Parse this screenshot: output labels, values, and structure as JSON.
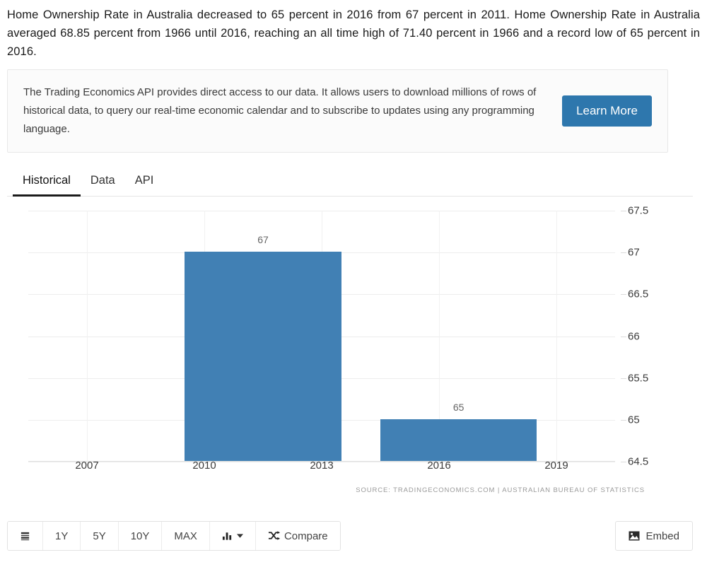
{
  "intro": {
    "paragraph": "Home Ownership Rate in Australia decreased to 65 percent in 2016 from 67 percent in 2011. Home Ownership Rate in Australia averaged 68.85 percent from 1966 until 2016, reaching an all time high of 71.40 percent in 1966 and a record low of 65 percent in 2016."
  },
  "api_banner": {
    "text": "The Trading Economics API provides direct access to our data. It allows users to download millions of rows of historical data, to query our real-time economic calendar and to subscribe to updates using any programming language.",
    "button_label": "Learn More",
    "button_color": "#2e77ad"
  },
  "tabs": [
    {
      "label": "Historical",
      "active": true
    },
    {
      "label": "Data",
      "active": false
    },
    {
      "label": "API",
      "active": false
    }
  ],
  "chart_data": {
    "type": "bar",
    "title": "",
    "xlabel": "",
    "ylabel": "",
    "categories": [
      2011,
      2016
    ],
    "values": [
      67,
      65
    ],
    "data_labels": [
      "67",
      "65"
    ],
    "bar_color": "#4180b4",
    "ylim": [
      64.5,
      67.5
    ],
    "yticks": [
      67.5,
      67,
      66.5,
      66,
      65.5,
      65,
      64.5
    ],
    "ytick_labels": [
      "67.5",
      "67",
      "66.5",
      "66",
      "65.5",
      "65",
      "64.5"
    ],
    "xlim": [
      2005.5,
      2020.5
    ],
    "xticks": [
      2007,
      2010,
      2013,
      2016,
      2019
    ],
    "xtick_labels": [
      "2007",
      "2010",
      "2013",
      "2016",
      "2019"
    ],
    "grid": true,
    "legend": false
  },
  "chart": {
    "source": "SOURCE: TRADINGECONOMICS.COM | AUSTRALIAN BUREAU OF STATISTICS"
  },
  "toolbar": {
    "range_buttons": [
      "1Y",
      "5Y",
      "10Y",
      "MAX"
    ],
    "chart_type_label": "",
    "compare_label": "Compare",
    "embed_label": "Embed"
  }
}
